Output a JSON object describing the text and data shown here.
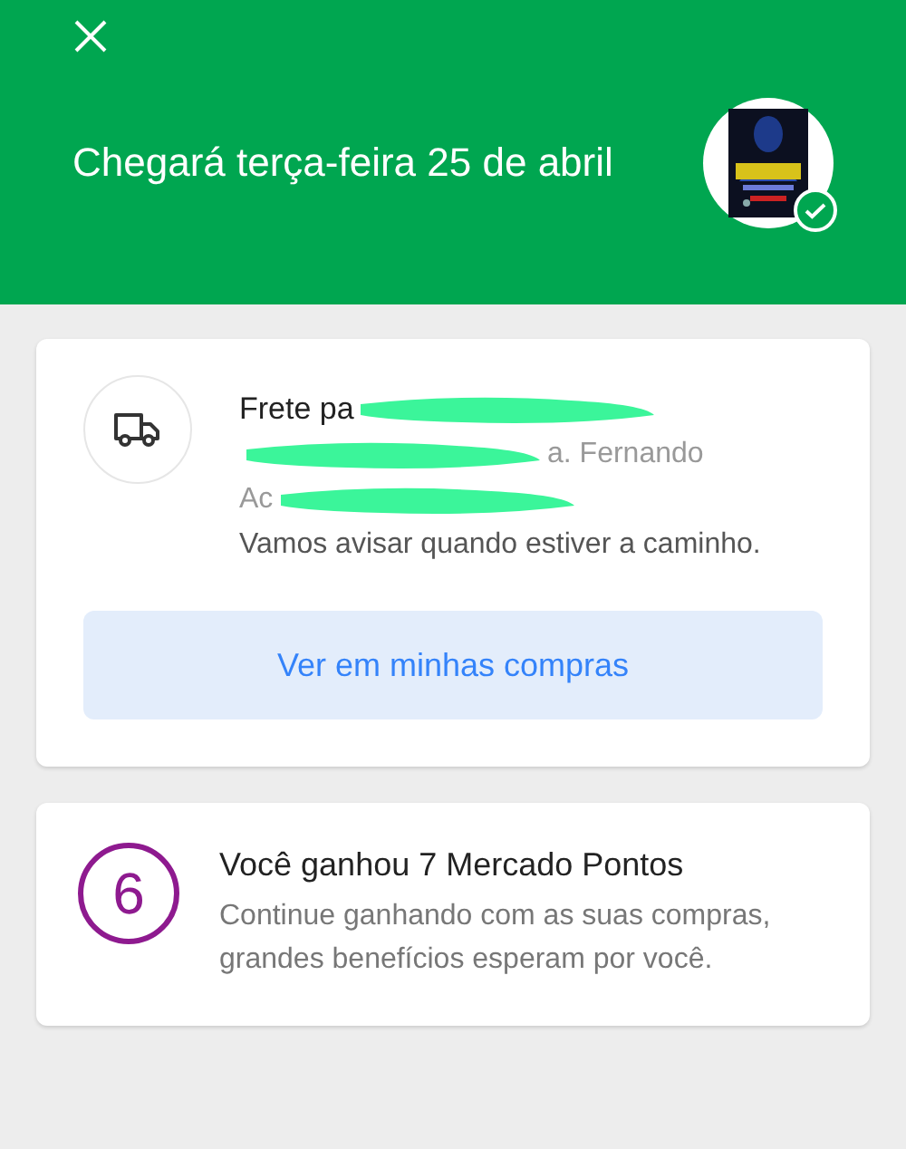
{
  "header": {
    "title": "Chegará terça-feira 25 de abril",
    "delivered": true
  },
  "shipping_card": {
    "lines": [
      {
        "kind": "title",
        "segments": [
          {
            "kind": "text",
            "text": "Frete pa"
          },
          {
            "kind": "redacted"
          }
        ]
      },
      {
        "kind": "detail",
        "segments": [
          {
            "kind": "redacted"
          },
          {
            "kind": "text",
            "text": "a. Fernando"
          }
        ]
      },
      {
        "kind": "detail",
        "segments": [
          {
            "kind": "text",
            "text": "Ac"
          },
          {
            "kind": "redacted"
          }
        ]
      },
      {
        "kind": "detail",
        "segments": [
          {
            "kind": "text",
            "text": "Vamos avisar quando estiver a caminho."
          }
        ]
      }
    ],
    "button": "Ver em minhas compras"
  },
  "points_card": {
    "level_badge": "6",
    "title": "Você ganhou 7 Mercado Pontos",
    "body": "Continue ganhando com as suas compras, grandes benefícios esperam por você."
  }
}
